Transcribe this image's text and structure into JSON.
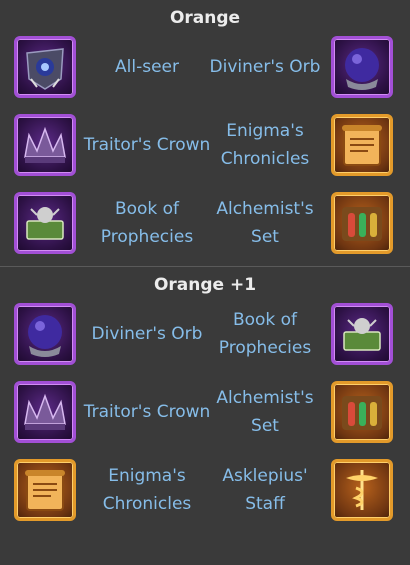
{
  "sections": [
    {
      "title": "Orange",
      "rows": [
        {
          "left": {
            "name": "All-seer",
            "icon": "all-seer-icon",
            "rarity": "purple"
          },
          "right": {
            "name": "Diviner's Orb",
            "icon": "diviners-orb-icon",
            "rarity": "purple"
          }
        },
        {
          "left": {
            "name": "Traitor's Crown",
            "icon": "traitors-crown-icon",
            "rarity": "purple"
          },
          "right": {
            "name": "Enigma's Chronicles",
            "icon": "enigmas-chronicles-icon",
            "rarity": "orange"
          }
        },
        {
          "left": {
            "name": "Book of Prophecies",
            "icon": "book-of-prophecies-icon",
            "rarity": "purple"
          },
          "right": {
            "name": "Alchemist's Set",
            "icon": "alchemists-set-icon",
            "rarity": "orange"
          }
        }
      ]
    },
    {
      "title": "Orange +1",
      "rows": [
        {
          "left": {
            "name": "Diviner's Orb",
            "icon": "diviners-orb-icon",
            "rarity": "purple"
          },
          "right": {
            "name": "Book of Prophecies",
            "icon": "book-of-prophecies-icon",
            "rarity": "purple"
          }
        },
        {
          "left": {
            "name": "Traitor's Crown",
            "icon": "traitors-crown-icon",
            "rarity": "purple"
          },
          "right": {
            "name": "Alchemist's Set",
            "icon": "alchemists-set-icon",
            "rarity": "orange"
          }
        },
        {
          "left": {
            "name": "Enigma's Chronicles",
            "icon": "enigmas-chronicles-icon",
            "rarity": "orange"
          },
          "right": {
            "name": "Asklepius' Staff",
            "icon": "asklepius-staff-icon",
            "rarity": "orange"
          }
        }
      ]
    }
  ],
  "colors": {
    "background": "#3a3a3a",
    "title": "#ececec",
    "label": "#86bde9",
    "purple_frame": "#a24fd6",
    "orange_frame": "#e39a2a"
  }
}
